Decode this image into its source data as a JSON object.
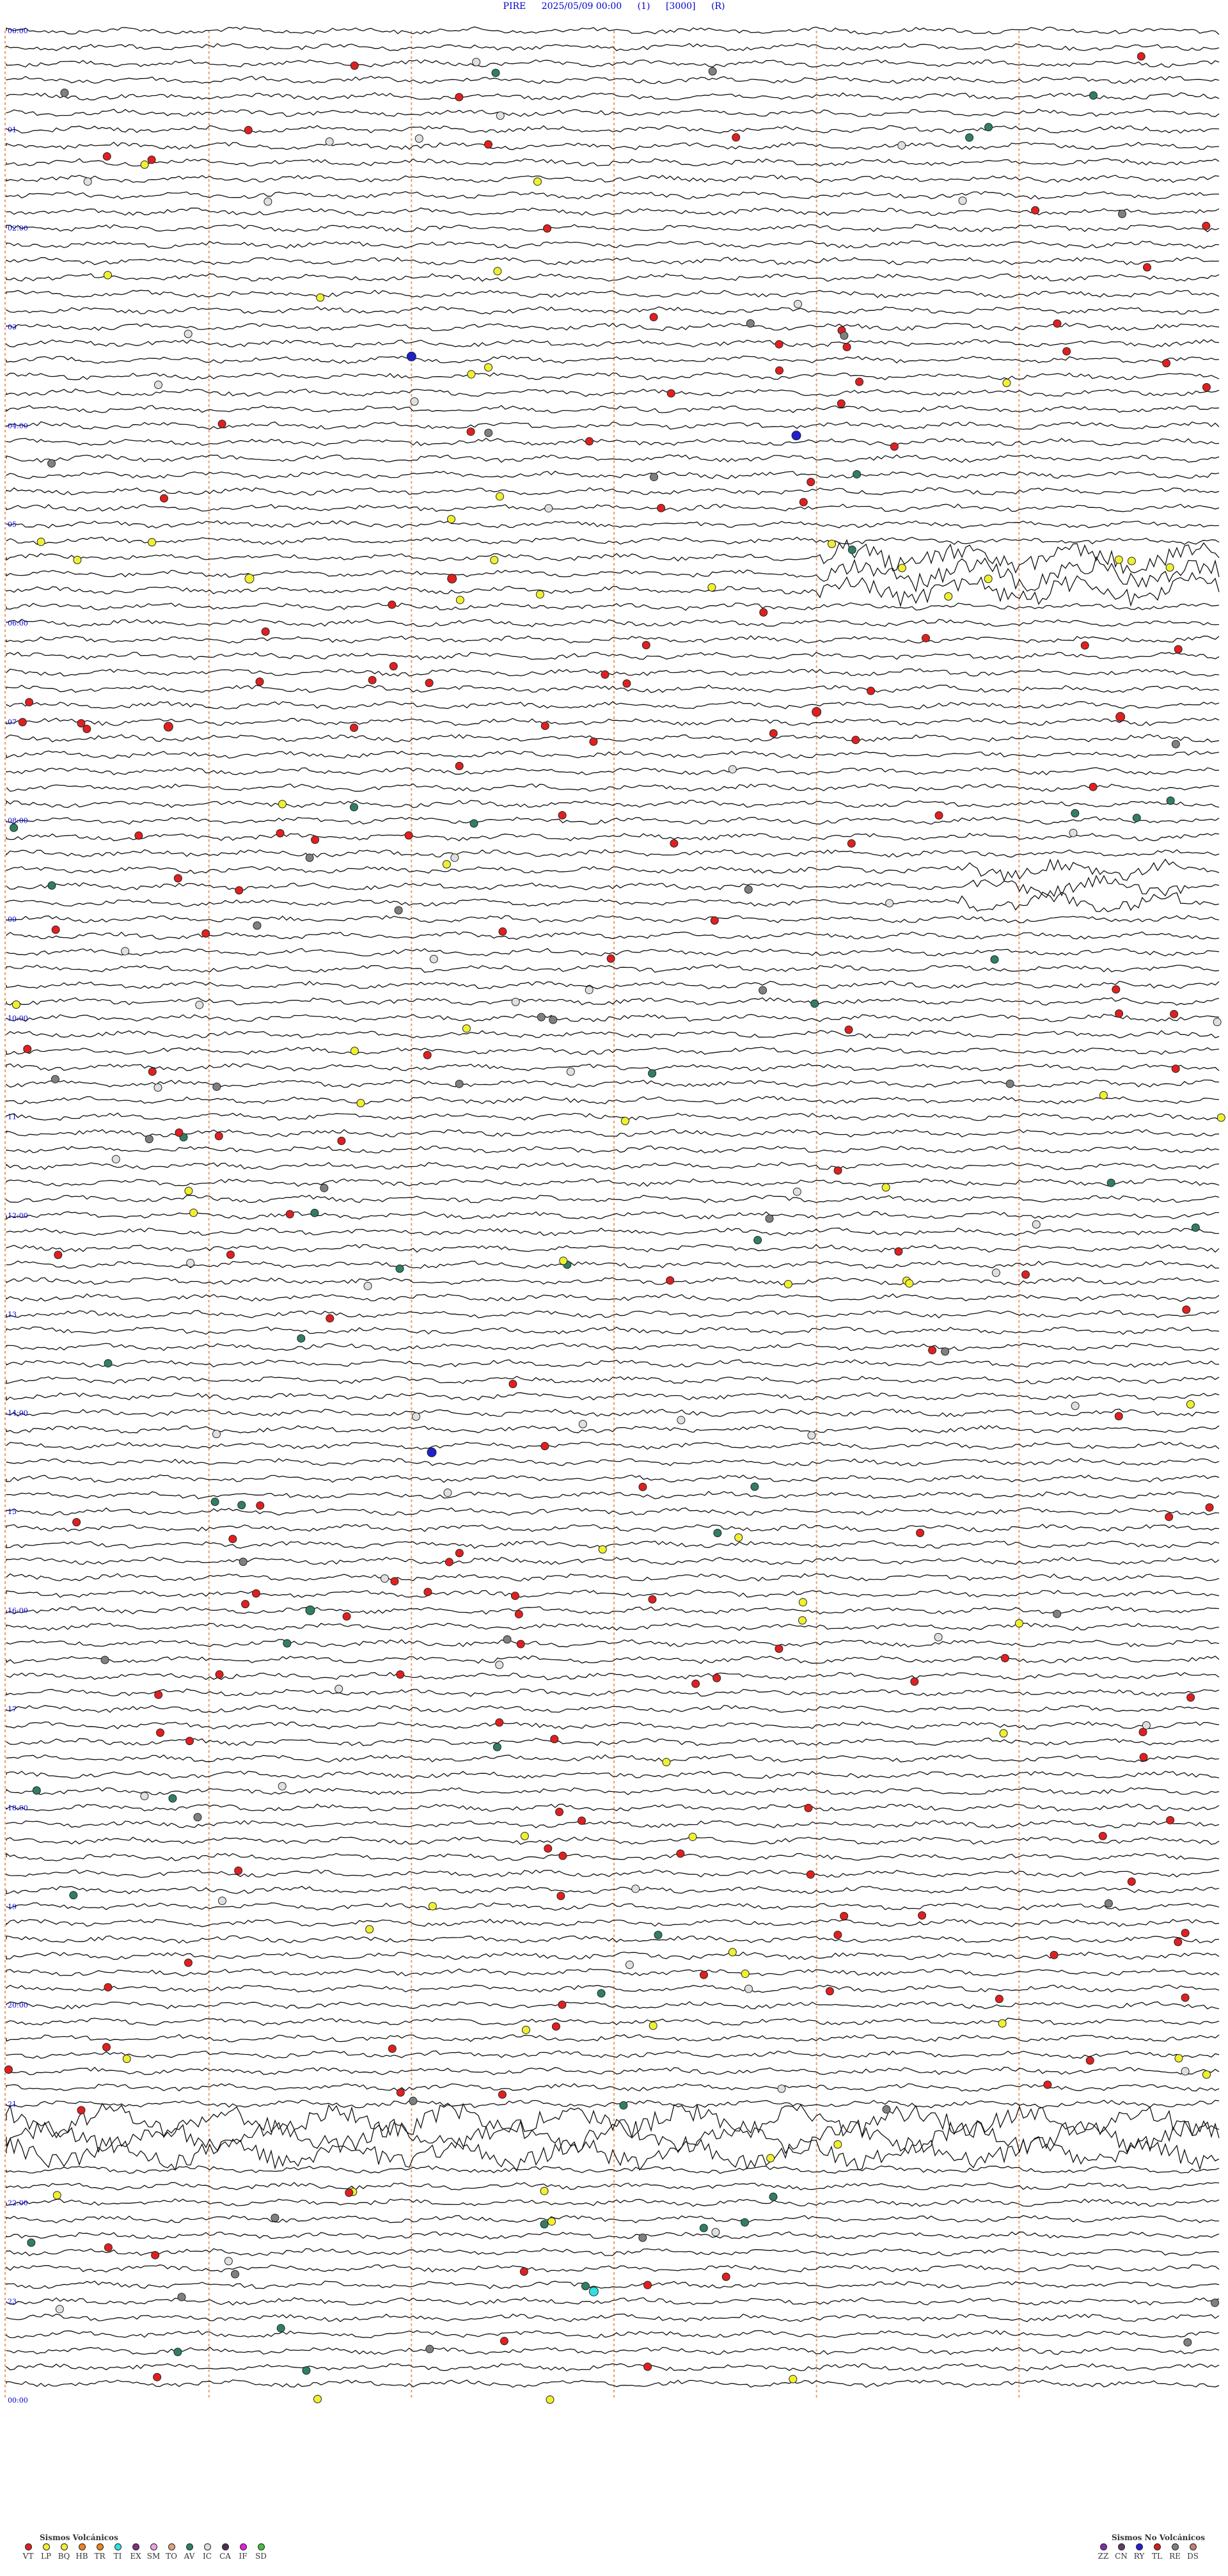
{
  "header": {
    "station": "PIRE",
    "datetime": "2025/05/09 00:00",
    "channel": "(1)",
    "scale": "[3000]",
    "mode": "(R)"
  },
  "chart_data": {
    "type": "helicorder",
    "hours": [
      "00:00",
      "01",
      "02:00",
      "03",
      "04:00",
      "05",
      "06:00",
      "07",
      "08:00",
      "09",
      "10:00",
      "11",
      "12:00",
      "13",
      "14:00",
      "15",
      "16:00",
      "17",
      "18:00",
      "19",
      "20:00",
      "21",
      "22:00",
      "23",
      "00:00"
    ],
    "traces_per_hour": 6,
    "minute_gridlines": [
      10,
      20,
      30,
      40,
      50
    ],
    "gridline_color": "#e8a070",
    "noisy_hours": [
      {
        "hour": 5.5,
        "minute_from": 45,
        "minute_to": 65,
        "amplitude": "high"
      },
      {
        "hour": 8.6,
        "minute_from": 52,
        "minute_to": 58,
        "amplitude": "medium"
      },
      {
        "hour": 21.3,
        "minute_from": 0,
        "minute_to": 60,
        "amplitude": "high"
      }
    ],
    "events": [
      {
        "hour": 5.55,
        "minute": 12,
        "type": "LP"
      },
      {
        "hour": 5.55,
        "minute": 22,
        "type": "VT"
      },
      {
        "hour": 6.9,
        "minute": 40,
        "type": "VT"
      },
      {
        "hour": 6.95,
        "minute": 55,
        "type": "VT"
      },
      {
        "hour": 7.05,
        "minute": 8,
        "type": "VT"
      },
      {
        "hour": 3.3,
        "minute": 20,
        "type": "RY"
      },
      {
        "hour": 4.1,
        "minute": 39,
        "type": "RY"
      },
      {
        "hour": 22.9,
        "minute": 29,
        "type": "TI"
      },
      {
        "hour": 14.4,
        "minute": 21,
        "type": "RY"
      },
      {
        "hour": 16.0,
        "minute": 15,
        "type": "AV"
      }
    ]
  },
  "legend": {
    "volcanic_title": "Sismos Volcánicos",
    "volcanic": [
      {
        "code": "VT",
        "color": "#e02020"
      },
      {
        "code": "LP",
        "color": "#f0f030"
      },
      {
        "code": "BQ",
        "color": "#f0f030"
      },
      {
        "code": "HB",
        "color": "#f08020"
      },
      {
        "code": "TR",
        "color": "#f08020"
      },
      {
        "code": "TI",
        "color": "#30e0e0"
      },
      {
        "code": "EX",
        "color": "#803080"
      },
      {
        "code": "SM",
        "color": "#f0a0e0"
      },
      {
        "code": "TO",
        "color": "#e0a080"
      },
      {
        "code": "AV",
        "color": "#308060"
      },
      {
        "code": "IC",
        "color": "#e0e0e0"
      },
      {
        "code": "CA",
        "color": "#503050"
      },
      {
        "code": "IF",
        "color": "#e020e0"
      },
      {
        "code": "SD",
        "color": "#40c040"
      }
    ],
    "non_volcanic_title": "Sismos No Volcánicos",
    "non_volcanic": [
      {
        "code": "ZZ",
        "color": "#8030a0"
      },
      {
        "code": "CN",
        "color": "#604060"
      },
      {
        "code": "RY",
        "color": "#2020d0"
      },
      {
        "code": "TL",
        "color": "#d02020"
      },
      {
        "code": "RE",
        "color": "#808080"
      },
      {
        "code": "DS",
        "color": "#c08070"
      }
    ]
  }
}
